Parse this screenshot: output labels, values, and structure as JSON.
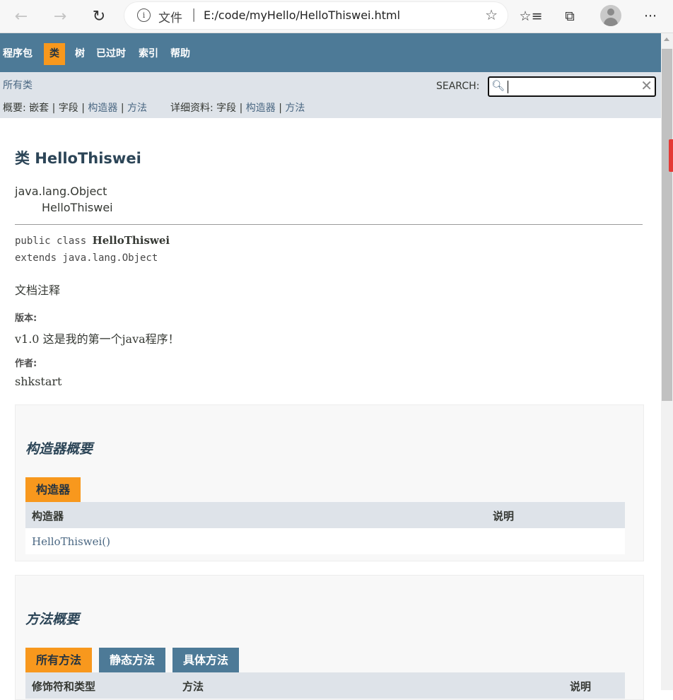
{
  "browser": {
    "address_label": "文件",
    "address_sep": "|",
    "url": "E:/code/myHello/HelloThiswei.html"
  },
  "topnav": [
    "程序包",
    "类",
    "树",
    "已过时",
    "索引",
    "帮助"
  ],
  "subnav": {
    "all_classes": "所有类",
    "search_label": "SEARCH:",
    "summary_prefix": "概要:",
    "summary_nested": "嵌套",
    "summary_field": "字段",
    "summary_constructor": "构造器",
    "summary_method": "方法",
    "detail_prefix": "详细资料:",
    "detail_field": "字段",
    "detail_constructor": "构造器",
    "detail_method": "方法",
    "sep": "|"
  },
  "class": {
    "title": "类 HelloThiswei",
    "inherit_root": "java.lang.Object",
    "inherit_child": "HelloThiswei",
    "decl_prefix": "public class ",
    "decl_name": "HelloThiswei",
    "decl_extends": "extends java.lang.Object",
    "doc_comment": "文档注释",
    "version_label": "版本:",
    "version_value": "v1.0 这是我的第一个java程序！",
    "author_label": "作者:",
    "author_value": "shkstart"
  },
  "constructor_summary": {
    "heading": "构造器概要",
    "tab": "构造器",
    "col_constructor": "构造器",
    "col_description": "说明",
    "rows": [
      {
        "name": "HelloThiswei",
        "params": "()"
      }
    ]
  },
  "method_summary": {
    "heading": "方法概要",
    "tabs": [
      "所有方法",
      "静态方法",
      "具体方法"
    ],
    "col_modifier": "修饰符和类型",
    "col_method": "方法",
    "col_description": "说明"
  }
}
